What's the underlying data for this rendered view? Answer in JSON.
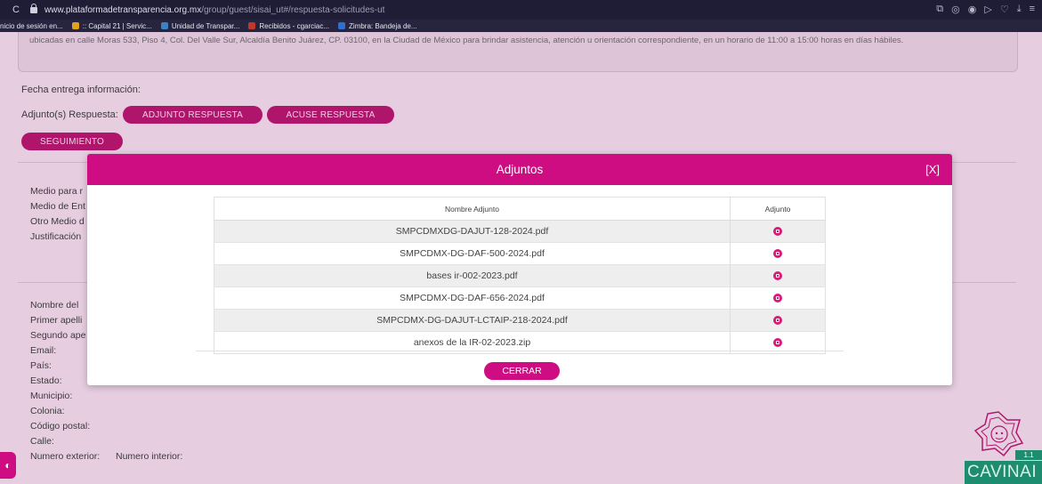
{
  "browser": {
    "url_host": "www.plataformadetransparencia.org.mx",
    "url_path": "/group/guest/sisai_ut#/respuesta-solicitudes-ut",
    "bookmarks": [
      {
        "label": "nicio de sesión en...",
        "color": "#26243e"
      },
      {
        "label": ":: Capital 21 | Servic...",
        "color": "#e0a21b"
      },
      {
        "label": "Unidad de Transpar...",
        "color": "#3b82c4"
      },
      {
        "label": "Recibidos - cgarciac...",
        "color": "#c0392b"
      },
      {
        "label": "Zimbra: Bandeja de...",
        "color": "#2f6fd1"
      }
    ]
  },
  "page": {
    "info_text": "ubicadas en calle Moras 533, Piso 4, Col. Del Valle Sur, Alcaldía Benito Juárez, CP. 03100, en la Ciudad de México para brindar asistencia, atención u orientación correspondiente, en un horario de 11:00 a 15:00 horas en días hábiles.",
    "fecha_entrega_label": "Fecha entrega información:",
    "adjuntos_label": "Adjunto(s) Respuesta:",
    "adjunto_respuesta_btn": "ADJUNTO RESPUESTA",
    "acuse_respuesta_btn": "ACUSE RESPUESTA",
    "seguimiento_btn": "SEGUIMIENTO",
    "fields_top": [
      "Medio para r",
      "Medio de Ent",
      "Otro Medio d",
      "Justificación"
    ],
    "fields_bottom": [
      "Nombre del",
      "Primer apelli",
      "Segundo ape",
      "Email:",
      "País:",
      "Estado:",
      "Municipio:",
      "Colonia:",
      "Código postal:",
      "Calle:"
    ],
    "numero_exterior": "Numero exterior:",
    "numero_interior": "Numero interior:"
  },
  "modal": {
    "title": "Adjuntos",
    "close": "[X]",
    "col_nombre": "Nombre Adjunto",
    "col_adjunto": "Adjunto",
    "files": [
      "SMPCDMXDG-DAJUT-128-2024.pdf",
      "SMPCDMX-DG-DAF-500-2024.pdf",
      "bases ir-002-2023.pdf",
      "SMPCDMX-DG-DAF-656-2024.pdf",
      "SMPCDMX-DG-DAJUT-LCTAIP-218-2024.pdf",
      "anexos de la IR-02-2023.zip"
    ],
    "download_icon": "download-icon",
    "cerrar_btn": "CERRAR"
  },
  "logo": {
    "text": "CAVINAI",
    "badge": "1.1"
  }
}
